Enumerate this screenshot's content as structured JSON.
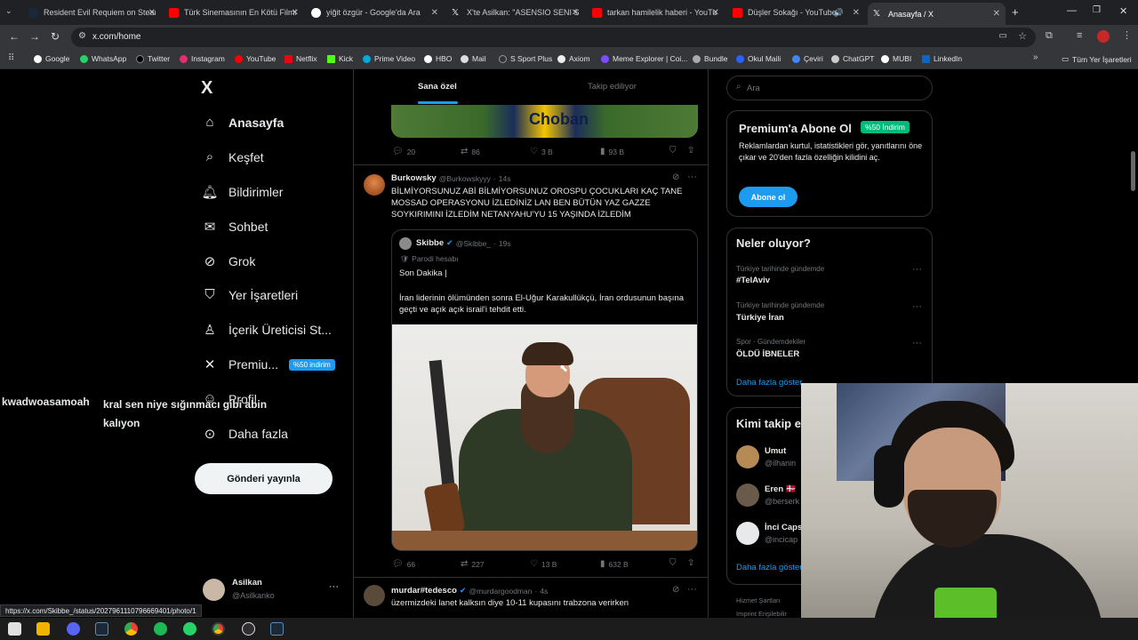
{
  "browser": {
    "tabs": [
      {
        "title": "Resident Evil Requiem on Steam",
        "color": "#1b2838"
      },
      {
        "title": "Türk Sinemasının En Kötü Filmi",
        "color": "#ff0000"
      },
      {
        "title": "yiğit özgür - Google'da Ara",
        "color": "#ffffff"
      },
      {
        "title": "X'te Asilkan: \"ASENSIO SENI SE",
        "color": "#ffffff"
      },
      {
        "title": "tarkan hamilelik haberi - YouTu",
        "color": "#ff0000"
      },
      {
        "title": "Düşler Sokağı - YouTube",
        "color": "#ff0000"
      },
      {
        "title": "Anasayfa / X",
        "color": "#ffffff"
      }
    ],
    "url": "x.com/home",
    "bookmarks": [
      "Google",
      "WhatsApp",
      "Twitter",
      "Instagram",
      "YouTube",
      "Netflix",
      "Kick",
      "Prime Video",
      "HBO",
      "Mail",
      "S Sport Plus",
      "Axiom",
      "Meme Explorer | Coi...",
      "Bundle",
      "Okul Maili",
      "Çeviri",
      "ChatGPT",
      "MUBI",
      "LinkedIn"
    ],
    "all_bookmarks": "Tüm Yer İşaretleri",
    "status_url": "https://x.com/Skibbe_/status/2027961110796669401/photo/1"
  },
  "sidebar": {
    "logo": "X",
    "items": [
      {
        "icon": "home-icon",
        "label": "Anasayfa"
      },
      {
        "icon": "search-icon",
        "label": "Keşfet"
      },
      {
        "icon": "bell-icon",
        "label": "Bildirimler"
      },
      {
        "icon": "mail-icon",
        "label": "Sohbet"
      },
      {
        "icon": "grok-icon",
        "label": "Grok"
      },
      {
        "icon": "bookmark-icon",
        "label": "Yer İşaretleri"
      },
      {
        "icon": "creator-icon",
        "label": "İçerik Üreticisi St..."
      },
      {
        "icon": "x-icon",
        "label": "Premiu..."
      },
      {
        "icon": "profile-icon",
        "label": "Profil"
      },
      {
        "icon": "more-icon",
        "label": "Daha fazla"
      }
    ],
    "premium_badge": "%50 indirim",
    "post_button": "Gönderi yayınla",
    "account": {
      "name": "Asilkan",
      "handle": "@Asilkanko"
    }
  },
  "feed": {
    "tabs": [
      "Sana özel",
      "Takip ediliyor"
    ],
    "first_tweet_image_text": "Choban",
    "first_tweet_actions": {
      "replies": "20",
      "retweets": "86",
      "likes": "3 B",
      "views": "93 B"
    },
    "tweet": {
      "name": "Burkowsky",
      "handle": "@Burkowskyyy",
      "time": "14s",
      "text": "BİLMİYORSUNUZ ABİ BİLMİYORSUNUZ OROSPU ÇOCUKLARI KAÇ TANE MOSSAD OPERASYONU İZLEDİNİZ LAN BEN BÜTÜN YAZ GAZZE SOYKIRIMINI İZLEDİM NETANYAHU'YU 15 YAŞINDA İZLEDİM",
      "quote": {
        "name": "Skibbe",
        "handle": "@Skibbe_",
        "time": "19s",
        "tag": "Parodi hesabı",
        "line1": "Son Dakika |",
        "line2": "İran liderinin ölümünden sonra El-Uğur Karakullükçü, İran ordusunun başına geçti ve açık açık israil'i tehdit etti."
      },
      "actions": {
        "replies": "66",
        "retweets": "227",
        "likes": "13 B",
        "views": "632 B"
      }
    },
    "next_tweet": {
      "name": "murdar#tedesco",
      "handle": "@murdargoodman",
      "time": "4s",
      "text": "üzermizdeki lanet kalksın diye 10-11 kupasını trabzona verirken"
    }
  },
  "right": {
    "search_placeholder": "Ara",
    "premium": {
      "title": "Premium'a Abone Ol",
      "badge": "%50 İndirim",
      "desc": "Reklamlardan kurtul, istatistikleri gör, yanıtlarını öne çıkar ve 20'den fazla özelliğin kilidini aç.",
      "button": "Abone ol"
    },
    "trends_title": "Neler oluyor?",
    "trends": [
      {
        "sub": "Türkiye tarihinde gündemde",
        "title": "#TelAviv"
      },
      {
        "sub": "Türkiye tarihinde gündemde",
        "title": "Türkiye İran"
      },
      {
        "sub": "Spor · Gündemdekiler",
        "title": "ÖLDÜ İBNELER"
      }
    ],
    "show_more": "Daha fazla göster",
    "who_to_follow_title": "Kimi takip e",
    "follow": [
      {
        "name": "Umut",
        "handle": "@ilhanin"
      },
      {
        "name": "Eren 🇩🇰",
        "handle": "@berserk"
      },
      {
        "name": "İnci Caps",
        "handle": "@incicap"
      }
    ],
    "show_more2": "Daha fazla göster",
    "footer1": "Hizmet Şartları",
    "footer2": "Imprint   Erişilebilir"
  },
  "chat_overlay": {
    "user": "kwadwoasamoah",
    "message": "kral sen niye sığınmacı gibi abin kalıyon"
  },
  "colors": {
    "accent": "#1d9bf0",
    "premium_badge": "#00ba7c"
  }
}
